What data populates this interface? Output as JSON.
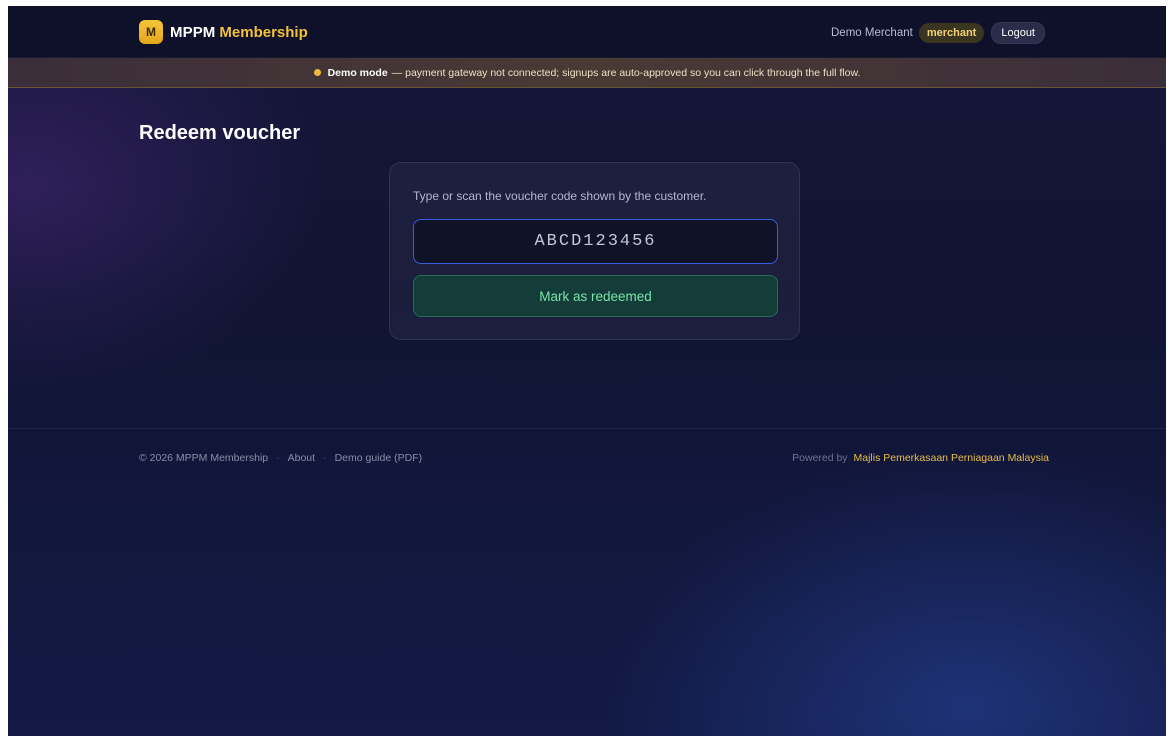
{
  "header": {
    "logo_letter": "M",
    "brand_primary": "MPPM",
    "brand_accent": "Membership",
    "user_name": "Demo Merchant",
    "role": "merchant",
    "logout_label": "Logout"
  },
  "banner": {
    "strong": "Demo mode",
    "text": "— payment gateway not connected; signups are auto-approved so you can click through the full flow."
  },
  "main": {
    "title": "Redeem voucher",
    "hint": "Type or scan the voucher code shown by the customer.",
    "voucher_code": "ABCD123456",
    "redeem_label": "Mark as redeemed"
  },
  "footer": {
    "copyright": "© 2026 MPPM Membership",
    "sep1": "·",
    "about": "About",
    "sep2": "·",
    "demo_guide": "Demo guide (PDF)",
    "powered_by": "Powered by",
    "org": "Majlis Pemerkasaan Perniagaan Malaysia"
  },
  "colors": {
    "accent": "#f2c03a",
    "success": "#7ae3a8",
    "input_border": "#3b5bdb"
  }
}
